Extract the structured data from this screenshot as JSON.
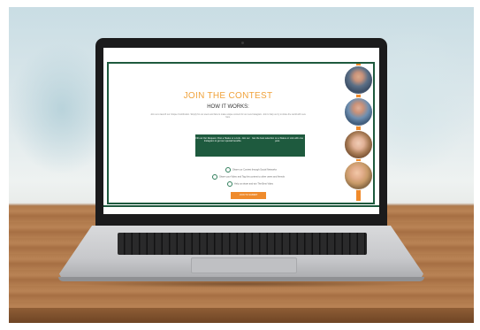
{
  "hero": {
    "title": "JOIN THE CONTEST",
    "subtitle": "HOW IT WORKS:",
    "intro": "Join us to launch our Unique Contribution. Simply for our users and fans to make unique content for our new Instagram. Join to help us try to share the world with new fans."
  },
  "cards": [
    {
      "text": "Fill out Our Request. Post a Status or a Link. Join our Instagram to get our special benefits."
    },
    {
      "text": "Get the best selection on a Status or Link with one post."
    }
  ],
  "steps": [
    {
      "text": "Share our Contest through Social Networks"
    },
    {
      "text": "Share your Video and Tag this contest to other users and friends"
    },
    {
      "text": "Help us share and win The Best Video"
    }
  ],
  "cta": {
    "label": "JOIN TO SUBMIT"
  },
  "colors": {
    "accent": "#f0a23b",
    "brand_green": "#1e5a3e",
    "button": "#ef8b2c"
  },
  "sidebar": {
    "avatars": [
      "avatar-man-blue-jacket",
      "avatar-man-blue-shirt",
      "avatar-woman-light-hair",
      "avatar-woman-hand-on-face"
    ]
  }
}
